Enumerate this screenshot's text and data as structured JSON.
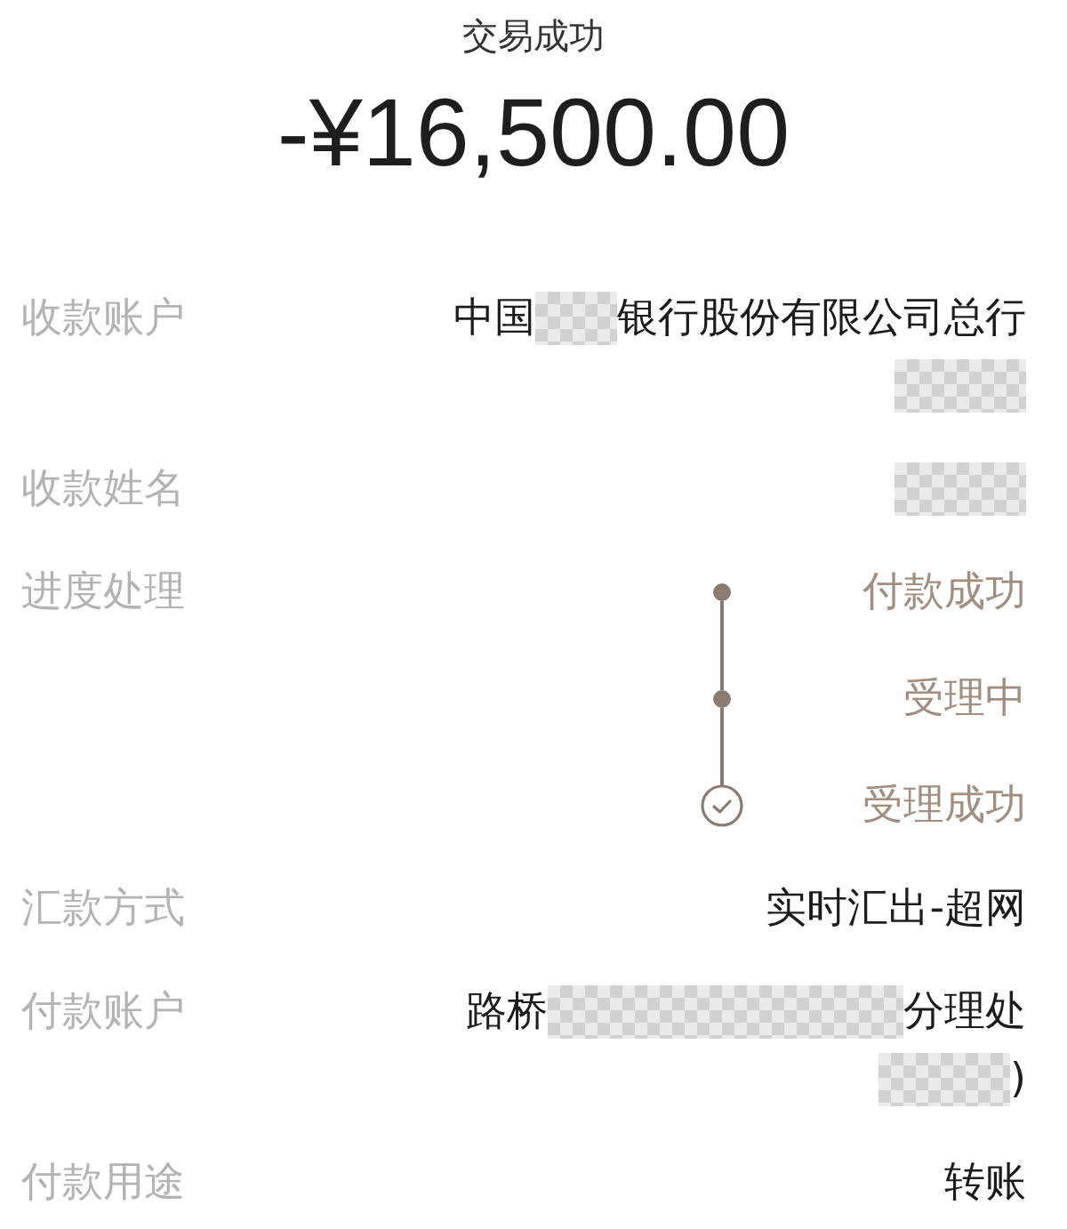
{
  "header": {
    "status": "交易成功",
    "amount": "-¥16,500.00"
  },
  "details": [
    {
      "label": "收款账户",
      "kind": "lines",
      "lines": [
        [
          {
            "kind": "text",
            "text": "中国"
          },
          {
            "kind": "narrowblur"
          },
          {
            "kind": "text",
            "text": "银行股份有限公司总行"
          }
        ],
        [
          {
            "kind": "blur"
          }
        ]
      ]
    },
    {
      "label": "收款姓名",
      "kind": "lines",
      "lines": [
        [
          {
            "kind": "blur"
          }
        ]
      ]
    },
    {
      "label": "进度处理",
      "kind": "progress",
      "steps": [
        {
          "label": "付款成功",
          "kind": "dot"
        },
        {
          "label": "受理中",
          "kind": "dot"
        },
        {
          "label": "受理成功",
          "kind": "check"
        }
      ]
    },
    {
      "label": "汇款方式",
      "kind": "lines",
      "lines": [
        [
          {
            "kind": "text",
            "text": "实时汇出-超网"
          }
        ]
      ]
    },
    {
      "label": "付款账户",
      "kind": "lines",
      "lines": [
        [
          {
            "kind": "text",
            "text": "路桥"
          },
          {
            "kind": "wideblur"
          },
          {
            "kind": "text",
            "text": "分理处"
          }
        ],
        [
          {
            "kind": "blur"
          },
          {
            "kind": "text",
            "text": ")"
          }
        ]
      ]
    },
    {
      "label": "付款用途",
      "kind": "lines",
      "lines": [
        [
          {
            "kind": "text",
            "text": "转账"
          }
        ]
      ]
    }
  ]
}
